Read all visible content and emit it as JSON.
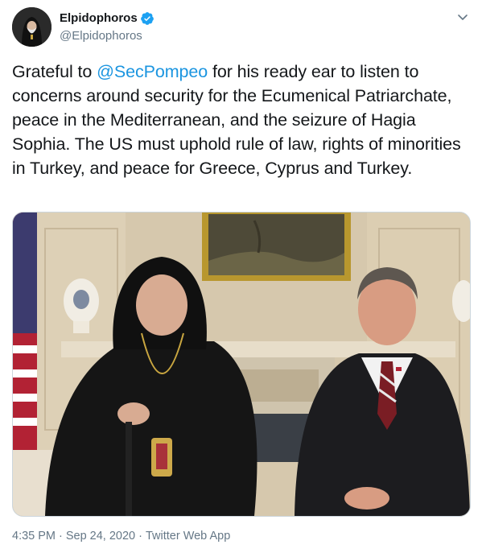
{
  "user": {
    "display_name": "Elpidophoros",
    "handle": "@Elpidophoros",
    "verified": true
  },
  "tweet": {
    "text_before": "Grateful to ",
    "mention": "@SecPompeo",
    "text_after": " for his ready ear to listen to concerns around security for the Ecumenical Patriarchate, peace in the Mediterranean, and the seizure of Hagia Sophia. The US must uphold rule of law, rights of minorities in Turkey, and peace for Greece, Cyprus and Turkey."
  },
  "meta": {
    "time": "4:35 PM",
    "separator": "·",
    "date": "Sep 24, 2020",
    "source": "Twitter Web App"
  },
  "colors": {
    "link": "#1b95e0",
    "secondary_text": "#657786",
    "verified": "#1da1f2"
  },
  "icons": {
    "verified": "verified-badge-icon",
    "menu": "chevron-down-icon"
  }
}
